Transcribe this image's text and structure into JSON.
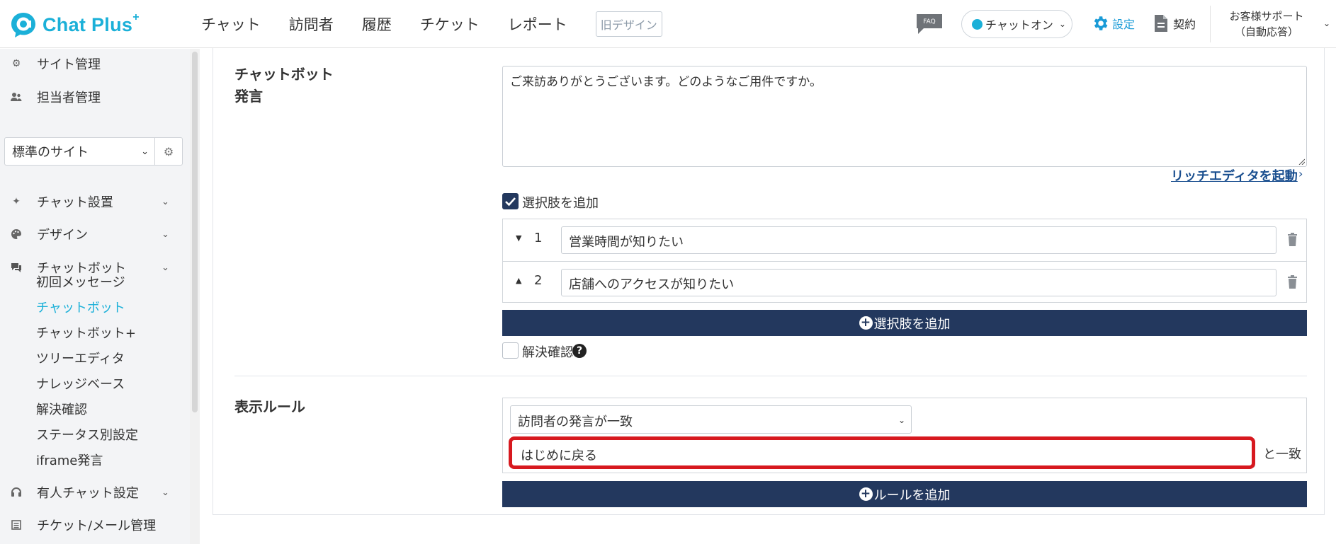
{
  "app": {
    "brand": "Chat Plus",
    "brand_sup": "+",
    "nav": [
      "チャット",
      "訪問者",
      "履歴",
      "チケット",
      "レポート"
    ],
    "old_design": "旧デザイン",
    "faq": "FAQ",
    "status": "チャットオン",
    "settings": "設定",
    "contract": "契約",
    "support_line1": "お客様サポート",
    "support_line2": "（自動応答）",
    "accent_color": "#1bb0d8",
    "navy_color": "#23385e",
    "highlight_color": "#d7191f"
  },
  "sidebar": {
    "site_admin": "サイト管理",
    "staff_admin": "担当者管理",
    "site_select": "標準のサイト",
    "chat_setup": "チャット設置",
    "design": "デザイン",
    "chatbot": "チャットボット",
    "sub": {
      "first_message": "初回メッセージ",
      "chatbot": "チャットボット",
      "chatbot_plus": "チャットボット+",
      "tree_editor": "ツリーエディタ",
      "knowledge_base": "ナレッジベース",
      "resolution": "解決確認",
      "status_settings": "ステータス別設定",
      "iframe": "iframe発言"
    },
    "manned_chat": "有人チャット設定",
    "ticket_mail": "チケット/メール管理"
  },
  "main": {
    "chatbot_label_1": "チャットボット",
    "chatbot_label_2": "発言",
    "message": "ご来訪ありがとうございます。どのようなご用件ですか。",
    "rich_editor": "リッチエディタを起動",
    "add_choices_check": "選択肢を追加",
    "choices": [
      {
        "num": "1",
        "text": "営業時間が知りたい"
      },
      {
        "num": "2",
        "text": "店舗へのアクセスが知りたい"
      }
    ],
    "add_choice_button": "選択肢を追加",
    "resolution_check": "解決確認",
    "rules_label": "表示ルール",
    "rule_condition": "訪問者の発言が一致",
    "rule_value": "はじめに戻る",
    "rule_suffix": "と一致",
    "add_rule_button": "ルールを追加"
  }
}
